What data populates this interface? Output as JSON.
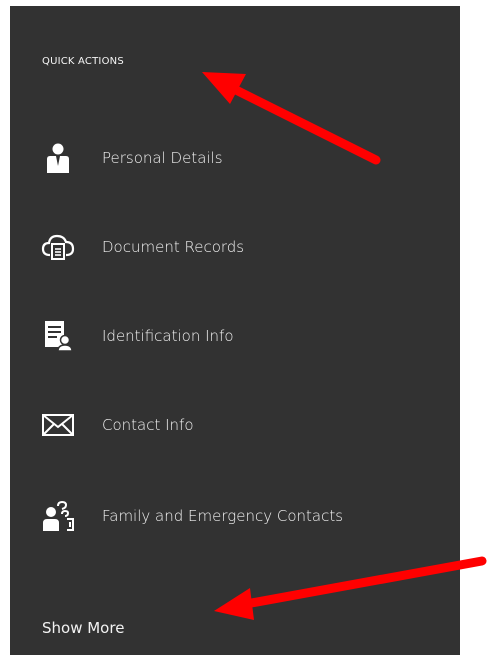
{
  "quick_actions": {
    "title": "QUICK ACTIONS",
    "items": [
      {
        "label": "Personal Details",
        "icon": "person-icon"
      },
      {
        "label": "Document Records",
        "icon": "cloud-document-icon"
      },
      {
        "label": "Identification Info",
        "icon": "id-document-icon"
      },
      {
        "label": "Contact Info",
        "icon": "envelope-icon"
      },
      {
        "label": "Family and Emergency Contacts",
        "icon": "family-contacts-icon"
      }
    ],
    "show_more": "Show More"
  },
  "colors": {
    "panel_background": "#323232",
    "text": "#f2f2f2",
    "annotation_arrow": "#ff0000"
  }
}
